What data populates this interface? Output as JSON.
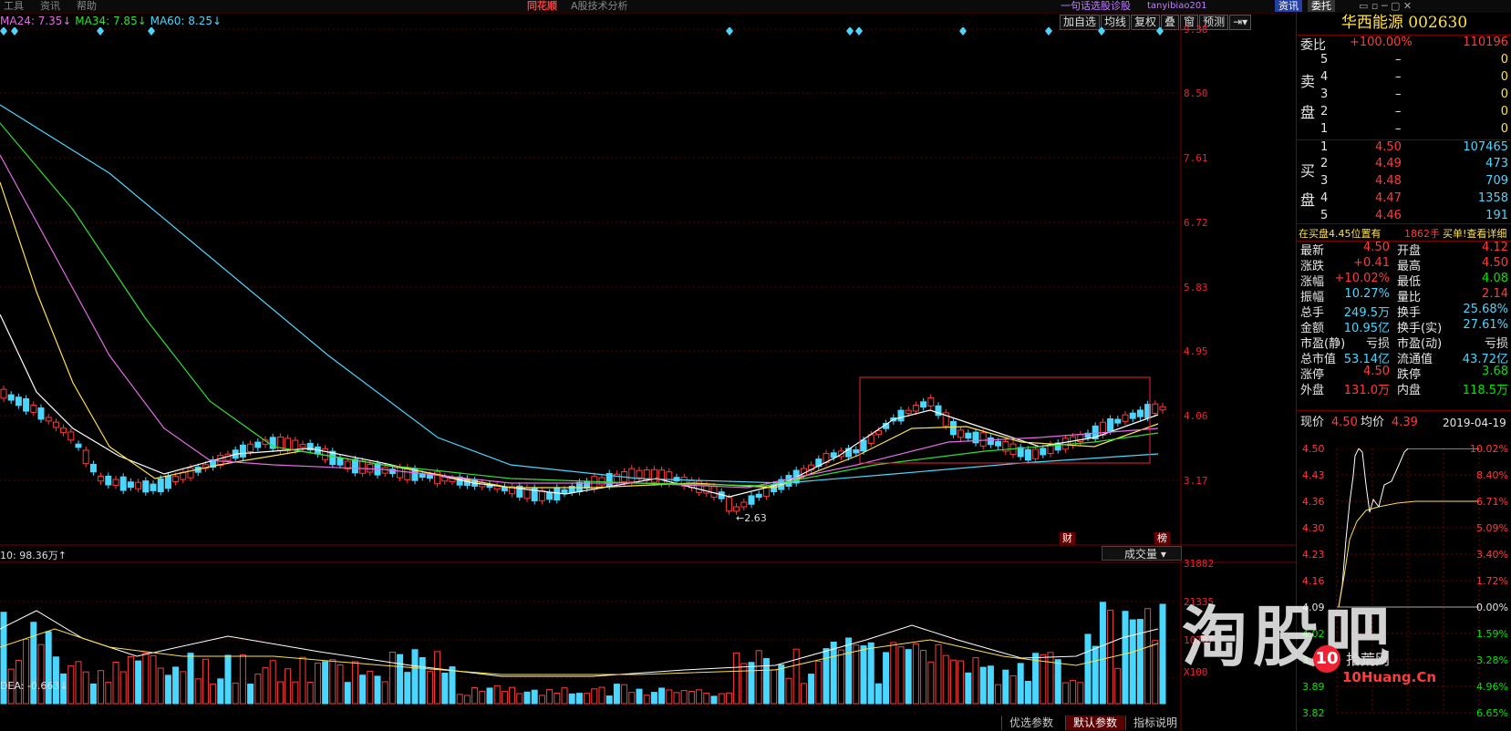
{
  "menu": [
    "工具",
    "资讯",
    "帮助"
  ],
  "app_brand": "同花顺",
  "window_title": "A股技术分析",
  "top_link": "一句话选股诊股",
  "user": "tanyibiao201",
  "top_tabs": [
    "资讯",
    "委托"
  ],
  "toolbar": [
    "加自选",
    "均线",
    "复权",
    "叠",
    "窗",
    "预测"
  ],
  "ma_legend": [
    {
      "text": "MA24: 7.35↓",
      "color": "#e66be6"
    },
    {
      "text": "MA34: 7.85↓",
      "color": "#2ee02e"
    },
    {
      "text": "MA60: 8.25↓",
      "color": "#4ad7ff"
    }
  ],
  "price_axis": [
    "9.38",
    "8.50",
    "7.61",
    "6.72",
    "5.83",
    "4.95",
    "4.06",
    "3.17"
  ],
  "low_label": "←2.63",
  "markers": {
    "cai": "财",
    "bang": "榜"
  },
  "volume": {
    "legend": "10: 98.36万↑",
    "selector": "成交量",
    "axis": [
      "31882",
      "21335",
      "10787",
      "X100"
    ]
  },
  "indicator_legend": "DEA: -0.663↓",
  "bottom_tabs": [
    "优选参数",
    "默认参数",
    "指标说明"
  ],
  "stock": {
    "name": "华西能源",
    "code": "002630"
  },
  "order_ratio": {
    "label": "委比",
    "pct": "+100.00%",
    "diff": "110196"
  },
  "sell": {
    "label_top": "卖",
    "label_bot": "盘",
    "rows": [
      {
        "lvl": "5",
        "price": "–",
        "vol": "0"
      },
      {
        "lvl": "4",
        "price": "–",
        "vol": "0"
      },
      {
        "lvl": "3",
        "price": "–",
        "vol": "0"
      },
      {
        "lvl": "2",
        "price": "–",
        "vol": "0"
      },
      {
        "lvl": "1",
        "price": "–",
        "vol": "0"
      }
    ]
  },
  "buy": {
    "label_top": "买",
    "label_bot": "盘",
    "rows": [
      {
        "lvl": "1",
        "price": "4.50",
        "vol": "107465"
      },
      {
        "lvl": "2",
        "price": "4.49",
        "vol": "473"
      },
      {
        "lvl": "3",
        "price": "4.48",
        "vol": "709"
      },
      {
        "lvl": "4",
        "price": "4.47",
        "vol": "1358"
      },
      {
        "lvl": "5",
        "price": "4.46",
        "vol": "191"
      }
    ]
  },
  "notice": {
    "left": "在买盘4.45位置有",
    "mid": "1862手",
    "right": "买单!查看详细"
  },
  "quote": [
    {
      "l1": "最新",
      "v1": "4.50",
      "c1": "red",
      "l2": "开盘",
      "v2": "4.12",
      "c2": "red"
    },
    {
      "l1": "涨跌",
      "v1": "+0.41",
      "c1": "red",
      "l2": "最高",
      "v2": "4.50",
      "c2": "red"
    },
    {
      "l1": "涨幅",
      "v1": "+10.02%",
      "c1": "red",
      "l2": "最低",
      "v2": "4.08",
      "c2": "green"
    },
    {
      "l1": "振幅",
      "v1": "10.27%",
      "c1": "cyan",
      "l2": "量比",
      "v2": "2.14",
      "c2": "red"
    },
    {
      "l1": "总手",
      "v1": "249.5万",
      "c1": "cyan",
      "l2": "换手",
      "v2": "25.68%",
      "c2": "cyan"
    },
    {
      "l1": "金额",
      "v1": "10.95亿",
      "c1": "cyan",
      "l2": "换手(实)",
      "v2": "27.61%",
      "c2": "cyan"
    },
    {
      "l1": "市盈(静)",
      "v1": "亏损",
      "c1": "white",
      "l2": "市盈(动)",
      "v2": "亏损",
      "c2": "white"
    },
    {
      "l1": "总市值",
      "v1": "53.14亿",
      "c1": "cyan",
      "l2": "流通值",
      "v2": "43.72亿",
      "c2": "cyan"
    },
    {
      "l1": "涨停",
      "v1": "4.50",
      "c1": "red",
      "l2": "跌停",
      "v2": "3.68",
      "c2": "green"
    },
    {
      "l1": "外盘",
      "v1": "131.0万",
      "c1": "red",
      "l2": "内盘",
      "v2": "118.5万",
      "c2": "green"
    }
  ],
  "mini": {
    "now_label": "现价",
    "now": "4.50",
    "avg_label": "均价",
    "avg": "4.39",
    "date": "2019-04-19",
    "left_axis": [
      "4.50",
      "4.43",
      "4.36",
      "4.30",
      "4.23",
      "4.16",
      "4.09",
      "4.02",
      "3.95",
      "3.89",
      "3.82"
    ],
    "right_axis": [
      "10.02%",
      "8.40%",
      "6.71%",
      "5.09%",
      "3.40%",
      "1.72%",
      "0.00%",
      "1.59%",
      "3.28%",
      "4.96%",
      "6.65%"
    ]
  },
  "watermark": {
    "main": "淘股吧",
    "site": "拾荒网",
    "url": "10Huang.Cn"
  },
  "colors": {
    "up": "#ff3b3b",
    "down": "#4ad7ff",
    "bg": "#000000",
    "grid": "#5a0000"
  }
}
